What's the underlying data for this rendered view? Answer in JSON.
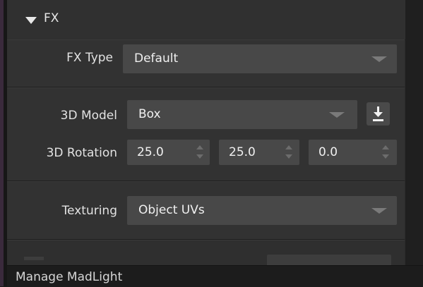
{
  "section": {
    "title": "FX",
    "collapse_icon": "triangle-down-icon"
  },
  "fx_type": {
    "label": "FX Type",
    "value": "Default"
  },
  "model": {
    "label": "3D Model",
    "value": "Box",
    "action_icon": "download-icon"
  },
  "rotation": {
    "label": "3D Rotation",
    "values": [
      "25.0",
      "25.0",
      "0.0"
    ]
  },
  "texturing": {
    "label": "Texturing",
    "value": "Object UVs"
  },
  "status_bar": {
    "text": "Manage MadLight"
  },
  "colors": {
    "panel_bg": "#2b2b2b",
    "group_bg": "#323232",
    "control_bg": "#484848",
    "text": "#e6e6e6",
    "accent": "#3a2a3c"
  }
}
